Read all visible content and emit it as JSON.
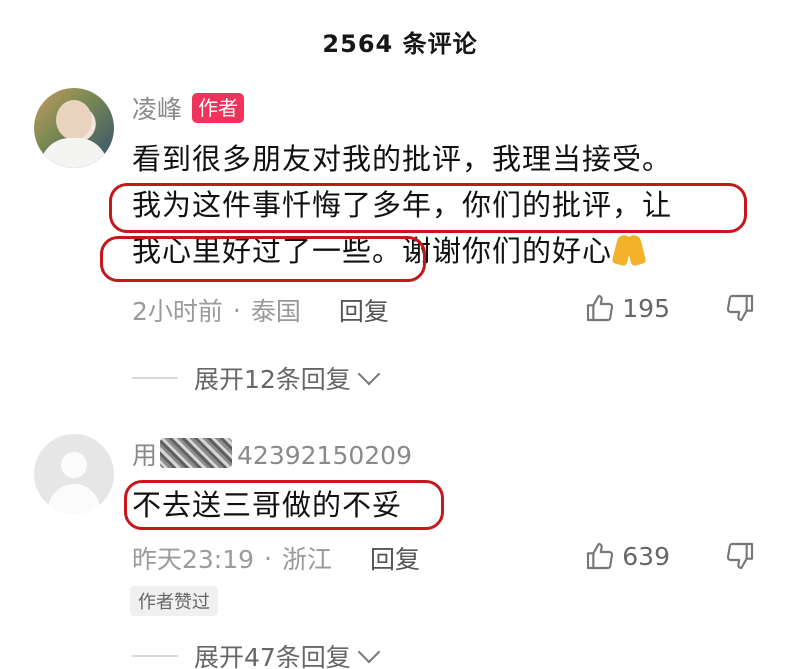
{
  "header": {
    "title": "2564 条评论"
  },
  "comments": [
    {
      "username": "凌峰",
      "badge": "作者",
      "text_lines": [
        "看到很多朋友对我的批评，我理当接受。",
        "我为这件事忏悔了多年，你们的批评，让",
        "我心里好过了一些。谢谢你们的好心"
      ],
      "time": "2小时前",
      "location": "泰国",
      "reply_label": "回复",
      "likes": "195",
      "expand_label": "展开12条回复"
    },
    {
      "username": "用户4239215020",
      "username_prefix": "用",
      "username_suffix": "42392150209",
      "text": "不去送三哥做的不妥",
      "time": "昨天23:19",
      "location": "浙江",
      "reply_label": "回复",
      "likes": "639",
      "liked_tag": "作者赞过",
      "expand_label": "展开47条回复"
    }
  ],
  "colors": {
    "badge": "#f0325c",
    "highlight_marker": "#c8161d",
    "prayer_emoji": "#f4b22a"
  },
  "icons": [
    "thumbs-up-icon",
    "thumbs-down-icon",
    "chevron-down-icon",
    "folded-hands-emoji"
  ]
}
